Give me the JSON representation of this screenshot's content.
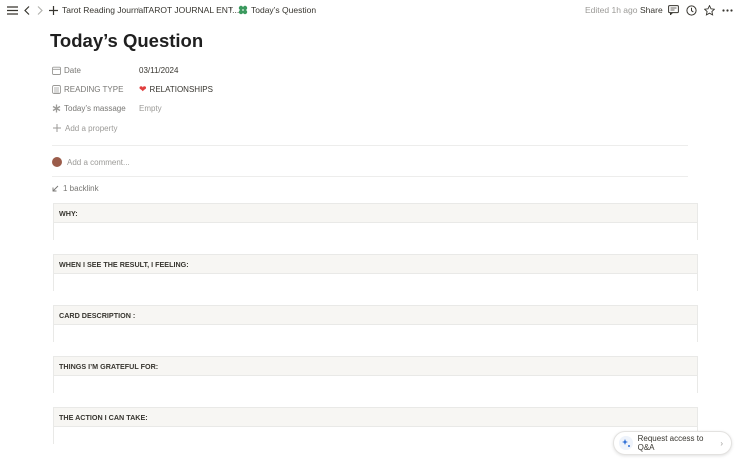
{
  "breadcrumbs": [
    {
      "label": "Tarot Reading Journal"
    },
    {
      "label": "TAROT JOURNAL ENT..."
    },
    {
      "label": "Today’s Question"
    }
  ],
  "header": {
    "edited": "Edited 1h ago",
    "share": "Share"
  },
  "page": {
    "title": "Today’s Question"
  },
  "properties": [
    {
      "label": "Date",
      "value": "03/11/2024",
      "icon": "calendar-icon"
    },
    {
      "label": "READING TYPE",
      "value": "RELATIONSHIPS",
      "icon": "list-icon"
    },
    {
      "label": "Today’s massage",
      "value": "Empty",
      "icon": "asterisk-icon"
    }
  ],
  "add_property": "Add a property",
  "comment_placeholder": "Add a comment...",
  "backlink": "1 backlink",
  "sections": [
    {
      "heading": "WHY:"
    },
    {
      "heading": "WHEN I SEE THE RESULT, I FEELING:"
    },
    {
      "heading": "CARD DESCRIPTION :"
    },
    {
      "heading": "THINGS I’M GRATEFUL FOR:"
    },
    {
      "heading": "THE ACTION I CAN TAKE:"
    }
  ],
  "qa_button": "Request access to Q&A",
  "colors": {
    "accent_heart": "#e03e3e",
    "block_header_bg": "#f7f6f3"
  }
}
